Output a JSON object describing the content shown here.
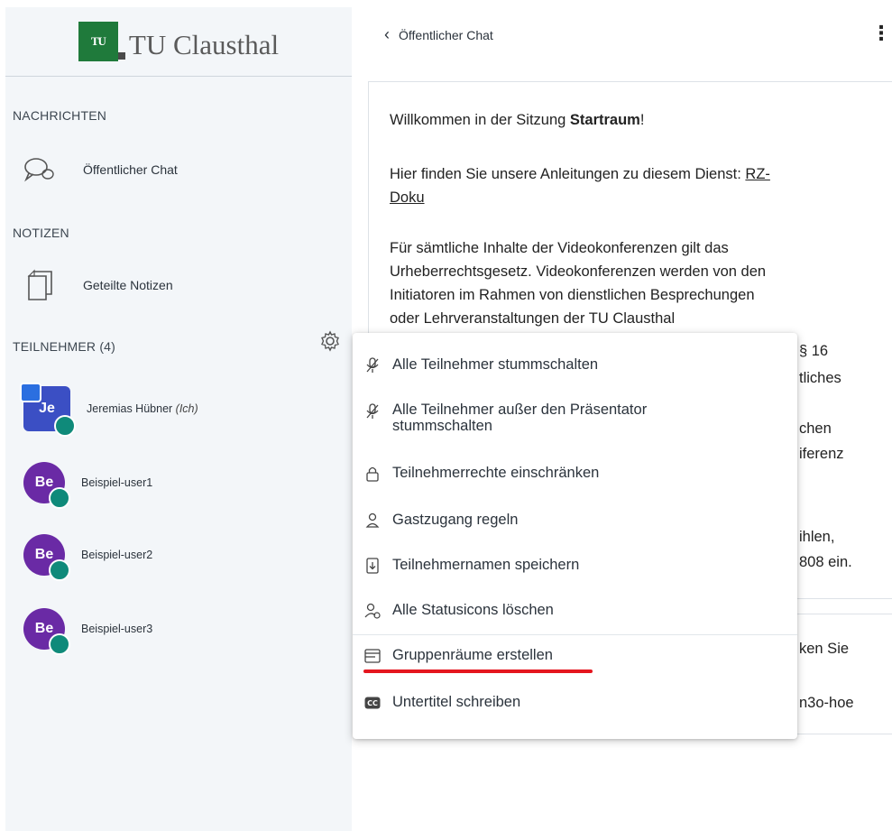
{
  "sidebar": {
    "logo_text": "TU Clausthal",
    "sections": {
      "messages": "NACHRICHTEN",
      "notes": "NOTIZEN",
      "participants": "TEILNEHMER (4)"
    },
    "public_chat": "Öffentlicher Chat",
    "shared_notes": "Geteilte Notizen",
    "users": [
      {
        "initials": "Je",
        "name": "Jeremias Hübner",
        "suffix": "(Ich)",
        "presenter": true
      },
      {
        "initials": "Be",
        "name": "Beispiel-user1",
        "suffix": "",
        "presenter": false
      },
      {
        "initials": "Be",
        "name": "Beispiel-user2",
        "suffix": "",
        "presenter": false
      },
      {
        "initials": "Be",
        "name": "Beispiel-user3",
        "suffix": "",
        "presenter": false
      }
    ]
  },
  "header": {
    "back_label": "Öffentlicher Chat"
  },
  "messages": {
    "welcome_prefix": "Willkommen in der Sitzung ",
    "welcome_room": "Startraum",
    "welcome_suffix": "!",
    "guides_prefix": "Hier finden Sie unsere Anleitungen zu diesem Dienst: ",
    "guides_link_1": "RZ-",
    "guides_link_2": "Doku",
    "copyright_lines": [
      "Für sämtliche Inhalte der Videokonferenzen gilt das",
      "Urheberrechtsgesetz. Videokonferenzen werden von den",
      "Initiatoren im Rahmen von dienstlichen Besprechungen",
      "oder Lehrveranstaltungen der TU Clausthal"
    ],
    "peek": [
      "§ 16",
      "tliches",
      "chen",
      "iferenz",
      "ihlen,",
      "808 ein.",
      "ken Sie",
      "n3o-hoe"
    ]
  },
  "menu": {
    "items": [
      {
        "icon": "mic-off-icon",
        "glyph": "🎙",
        "label": "Alle Teilnehmer stummschalten"
      },
      {
        "icon": "mic-off-icon",
        "glyph": "🎙",
        "label_1": "Alle Teilnehmer außer den Präsentator",
        "label_2": "stummschalten"
      },
      {
        "icon": "lock-icon",
        "glyph": "🔒",
        "label": "Teilnehmerrechte einschränken"
      },
      {
        "icon": "user-icon",
        "glyph": "👤",
        "label": "Gastzugang regeln"
      },
      {
        "icon": "download-file-icon",
        "glyph": "⤓",
        "label": "Teilnehmernamen speichern"
      },
      {
        "icon": "clear-status-icon",
        "glyph": "👤",
        "label": "Alle Statusicons löschen"
      },
      {
        "icon": "rooms-icon",
        "glyph": "▤",
        "label": "Gruppenräume erstellen"
      },
      {
        "icon": "closed-caption-icon",
        "glyph": "CC",
        "label": "Untertitel schreiben"
      }
    ]
  },
  "colors": {
    "avatar_purple": "#6a2aa5",
    "avatar_blue": "#3b4fc4",
    "status_teal": "#0f8a7a",
    "highlight_red": "#e5161f",
    "logo_green": "#1f7a3b"
  }
}
